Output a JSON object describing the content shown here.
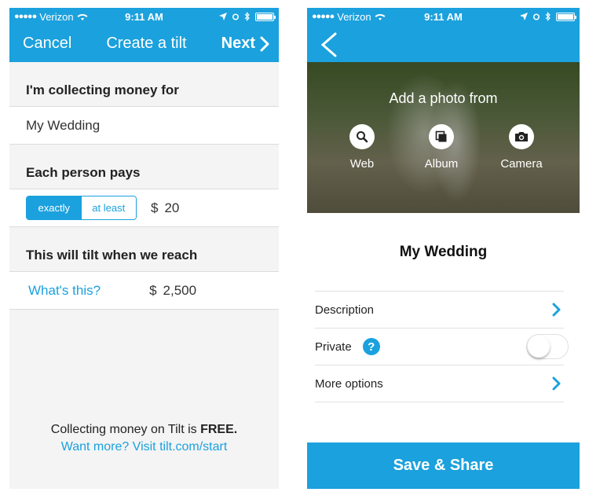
{
  "status_bar": {
    "carrier": "Verizon",
    "signal_dots": "●●●●●",
    "time": "9:11 AM"
  },
  "left": {
    "nav": {
      "cancel_label": "Cancel",
      "title": "Create a tilt",
      "next_label": "Next"
    },
    "collecting_label": "I'm collecting money for",
    "collecting_value": "My Wedding",
    "each_person_label": "Each person pays",
    "segmented": {
      "options": [
        "exactly",
        "at least"
      ],
      "selected": "exactly"
    },
    "amount": {
      "currency": "$",
      "value": "20"
    },
    "tilt_label": "This will tilt when we reach",
    "whats_this_label": "What's this?",
    "goal": {
      "currency": "$",
      "value": "2,500"
    },
    "footer": {
      "free_text_prefix": "Collecting money on Tilt is ",
      "free_text_bold": "FREE.",
      "link": "Want more? Visit tilt.com/start"
    }
  },
  "right": {
    "add_photo_label": "Add a photo from",
    "photo_options": [
      {
        "label": "Web",
        "icon": "search-icon"
      },
      {
        "label": "Album",
        "icon": "album-icon"
      },
      {
        "label": "Camera",
        "icon": "camera-icon"
      }
    ],
    "title": "My Wedding",
    "rows": {
      "description": "Description",
      "private": "Private",
      "private_help": "?",
      "private_enabled": false,
      "more_options": "More options"
    },
    "save_label": "Save & Share"
  },
  "colors": {
    "accent": "#1ba1dd",
    "background_left": "#f4f4f4",
    "text": "#222222"
  }
}
